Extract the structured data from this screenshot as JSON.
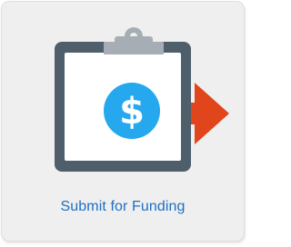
{
  "tile": {
    "label": "Submit for Funding",
    "icon": "clipboard-dollar-arrow-icon"
  },
  "colors": {
    "tile_background": "#efefef",
    "label_text": "#1f6fc1",
    "clipboard_frame": "#4f5e6b",
    "clipboard_paper": "#ffffff",
    "clip": "#a6adb4",
    "dollar_circle": "#25a8ee",
    "arrow": "#e0451c"
  }
}
